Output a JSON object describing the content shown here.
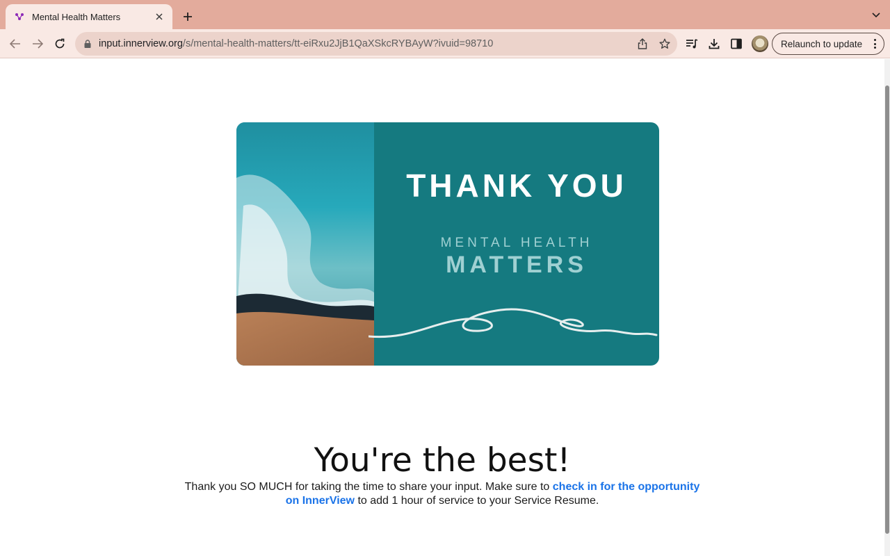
{
  "browser": {
    "tab_title": "Mental Health Matters",
    "url_host": "input.innerview.org",
    "url_path": "/s/mental-health-matters/tt-eiRxu2JjB1QaXSkcRYBAyW?ivuid=98710",
    "relaunch_label": "Relaunch to update",
    "accent_color": "#e3ab9c"
  },
  "banner": {
    "title": "THANK YOU",
    "subtitle_line1": "MENTAL HEALTH",
    "subtitle_line2": "MATTERS",
    "bg_color": "#157a80"
  },
  "content": {
    "headline": "You're the best!",
    "body_prefix": "Thank you SO MUCH for taking the time to share your input. Make sure to ",
    "link_text": "check in for the opportunity on InnerView",
    "body_suffix": " to add 1 hour of service to your Service Resume."
  }
}
